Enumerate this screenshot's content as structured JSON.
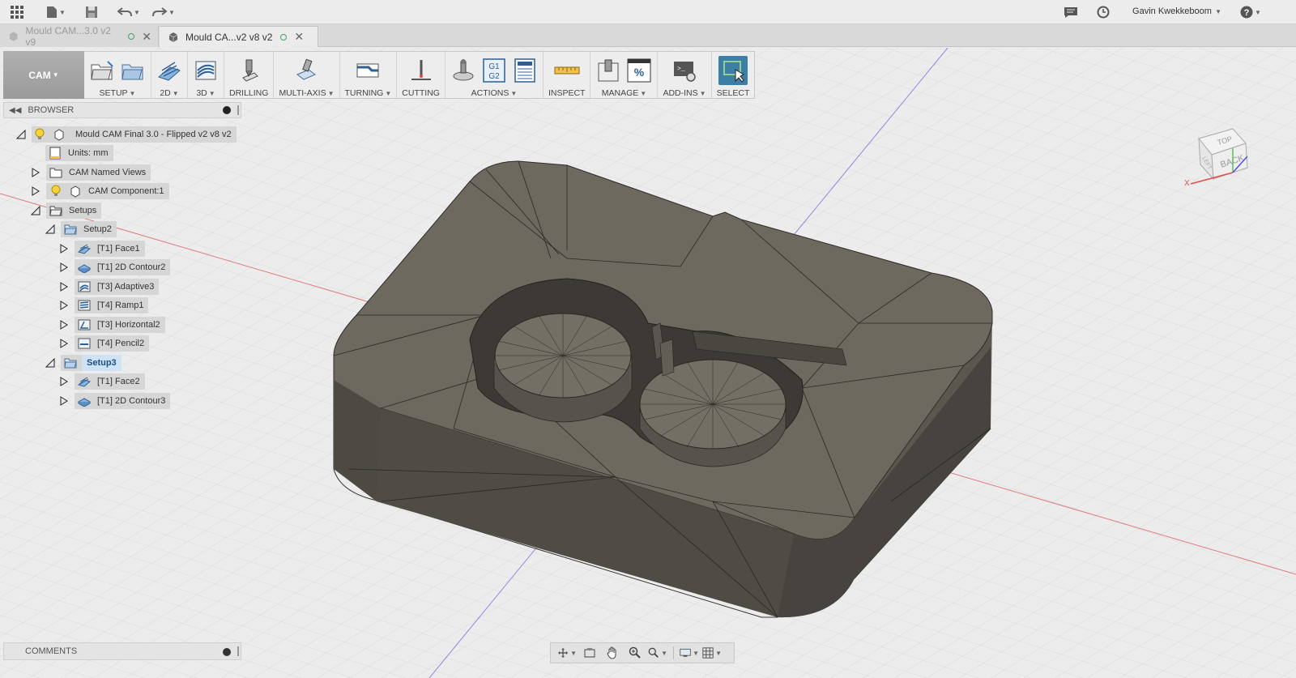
{
  "topbar": {
    "user_name": "Gavin Kwekkeboom"
  },
  "tabs": [
    {
      "label": "Mould CAM...3.0 v2 v9",
      "active": false
    },
    {
      "label": "Mould CA...v2 v8 v2",
      "active": true
    }
  ],
  "toolbar": {
    "workspace": "CAM",
    "groups": [
      {
        "label": "SETUP",
        "has_menu": true
      },
      {
        "label": "2D",
        "has_menu": true
      },
      {
        "label": "3D",
        "has_menu": true
      },
      {
        "label": "DRILLING",
        "has_menu": false
      },
      {
        "label": "MULTI-AXIS",
        "has_menu": true
      },
      {
        "label": "TURNING",
        "has_menu": true
      },
      {
        "label": "CUTTING",
        "has_menu": false
      },
      {
        "label": "ACTIONS",
        "has_menu": true
      },
      {
        "label": "INSPECT",
        "has_menu": false
      },
      {
        "label": "MANAGE",
        "has_menu": true
      },
      {
        "label": "ADD-INS",
        "has_menu": true
      },
      {
        "label": "SELECT",
        "has_menu": false
      }
    ],
    "g1g2_text": [
      "G1",
      "G2"
    ]
  },
  "browser": {
    "title": "BROWSER",
    "root": "Mould CAM Final 3.0 - Flipped v2 v8 v2",
    "units": "Units: mm",
    "named_views": "CAM Named Views",
    "component": "CAM Component:1",
    "setups": "Setups",
    "setup2": "Setup2",
    "setup2_ops": [
      "[T1] Face1",
      "[T1] 2D Contour2",
      "[T3] Adaptive3",
      "[T4] Ramp1",
      "[T3] Horizontal2",
      "[T4] Pencil2"
    ],
    "setup3": "Setup3",
    "setup3_ops": [
      "[T1] Face2",
      "[T1] 2D Contour3"
    ]
  },
  "comments": {
    "title": "COMMENTS"
  },
  "viewcube": {
    "back": "BACK",
    "top": "TOP",
    "left": "LEFT",
    "axis_x": "X"
  },
  "colors": {
    "selection": "#cfe3f7",
    "select_tool": "#3d7ea6",
    "model": "#6e695f",
    "grid": "#d9d9d9"
  }
}
